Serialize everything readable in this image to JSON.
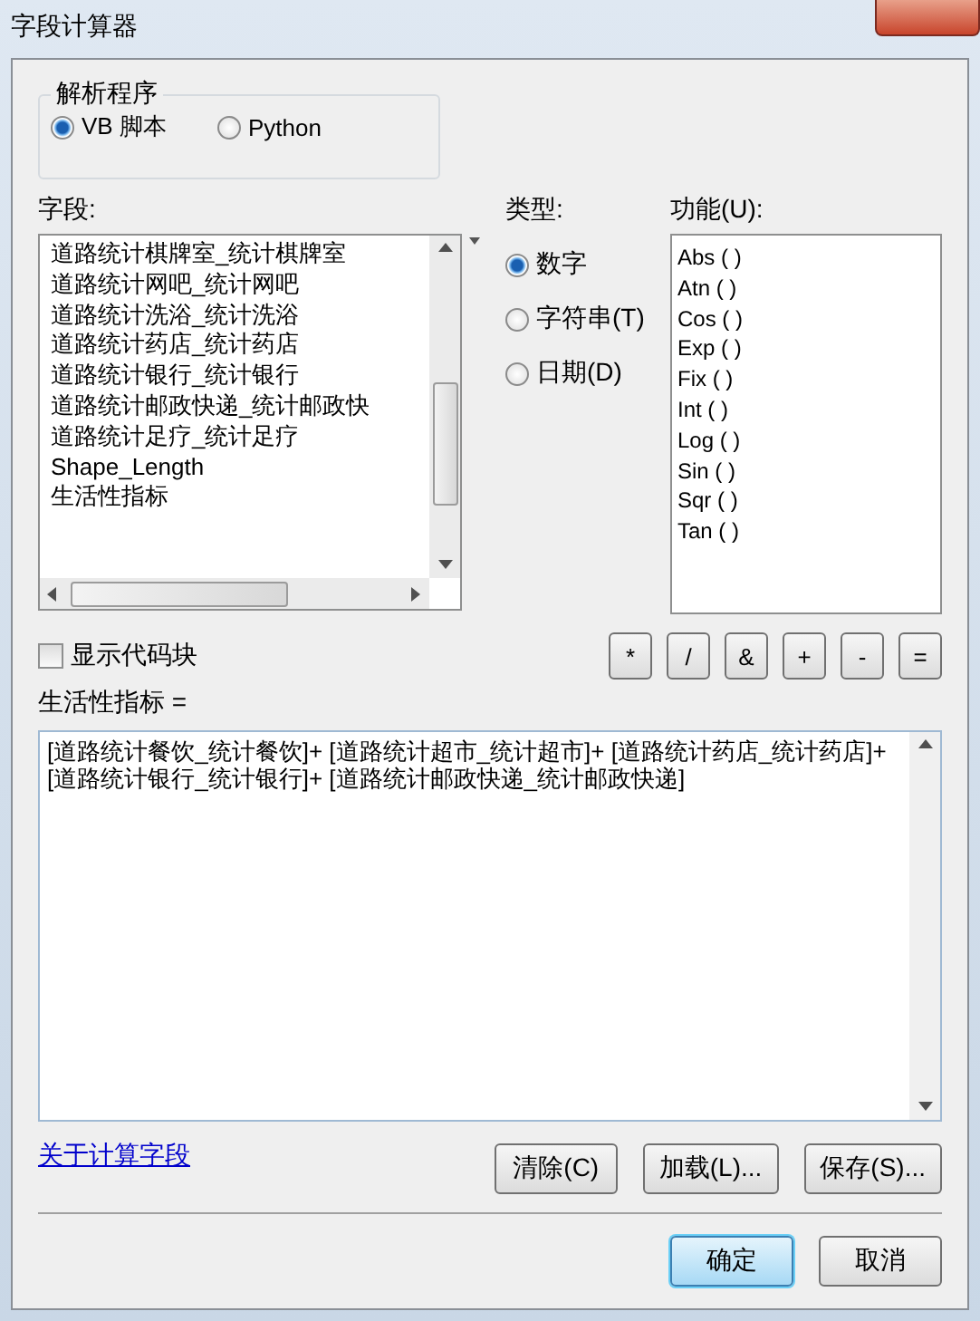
{
  "window": {
    "title": "字段计算器"
  },
  "parser": {
    "title": "解析程序",
    "options": [
      {
        "label": "VB 脚本",
        "selected": true
      },
      {
        "label": "Python",
        "selected": false
      }
    ]
  },
  "fields": {
    "label": "字段:",
    "items": [
      "道路统计棋牌室_统计棋牌室",
      "道路统计网吧_统计网吧",
      "道路统计洗浴_统计洗浴",
      "道路统计药店_统计药店",
      "道路统计银行_统计银行",
      "道路统计邮政快递_统计邮政快",
      "道路统计足疗_统计足疗",
      "Shape_Length",
      "生活性指标"
    ]
  },
  "type": {
    "label": "类型:",
    "options": [
      {
        "label": "数字",
        "selected": true
      },
      {
        "label": "字符串(T)",
        "selected": false
      },
      {
        "label": "日期(D)",
        "selected": false
      }
    ]
  },
  "functions": {
    "label": "功能(U):",
    "items": [
      "Abs ( )",
      "Atn ( )",
      "Cos ( )",
      "Exp ( )",
      "Fix ( )",
      "Int ( )",
      "Log ( )",
      "Sin ( )",
      "Sqr ( )",
      "Tan ( )"
    ]
  },
  "show_codeblock": {
    "label": "显示代码块",
    "checked": false
  },
  "operators": [
    "*",
    "/",
    "&",
    "+",
    "-",
    "="
  ],
  "expression": {
    "label": "生活性指标 =",
    "value": "[道路统计餐饮_统计餐饮]+ [道路统计超市_统计超市]+ [道路统计药店_统计药店]+ [道路统计银行_统计银行]+ [道路统计邮政快递_统计邮政快递]"
  },
  "about_link": "关于计算字段",
  "tool_buttons": [
    "清除(C)",
    "加载(L)...",
    "保存(S)..."
  ],
  "buttons": [
    {
      "label": "确定",
      "default": true
    },
    {
      "label": "取消",
      "default": false
    }
  ]
}
